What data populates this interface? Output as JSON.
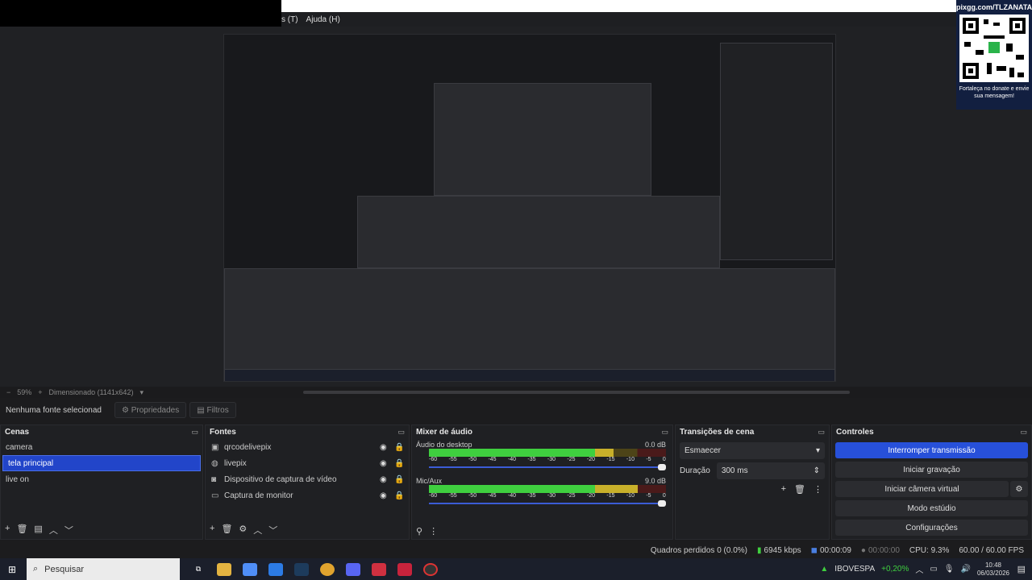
{
  "menu": {
    "items": [
      "s (T)",
      "Ajuda (H)"
    ]
  },
  "qr": {
    "url": "pixgg.com/TLZANATA",
    "message": "Fortaleça no donate e envie sua mensagem!"
  },
  "zoom": {
    "percent": "59%",
    "scaling": "Dimensionado (1141x642)"
  },
  "props": {
    "no_source": "Nenhuma fonte selecionad",
    "properties": "Propriedades",
    "filters": "Filtros"
  },
  "scenes": {
    "title": "Cenas",
    "items": [
      "camera",
      "tela principal",
      "live on"
    ],
    "selected": 1
  },
  "sources": {
    "title": "Fontes",
    "items": [
      {
        "label": "qrcodelivepix",
        "icon": "image-icon"
      },
      {
        "label": "livepix",
        "icon": "browser-icon"
      },
      {
        "label": "Dispositivo de captura de vídeo",
        "icon": "camera-icon"
      },
      {
        "label": "Captura de monitor",
        "icon": "monitor-icon"
      }
    ]
  },
  "mixer": {
    "title": "Mixer de áudio",
    "channels": [
      {
        "name": "Áudio do desktop",
        "db": "0.0 dB",
        "level": 0.78
      },
      {
        "name": "Mic/Aux",
        "db": "9.0 dB",
        "level": 0.92
      }
    ],
    "scale": [
      "-60",
      "-55",
      "-50",
      "-45",
      "-40",
      "-35",
      "-30",
      "-25",
      "-20",
      "-15",
      "-10",
      "-5",
      "0"
    ]
  },
  "transitions": {
    "title": "Transições de cena",
    "type": "Esmaecer",
    "duration_label": "Duração",
    "duration": "300 ms"
  },
  "controls": {
    "title": "Controles",
    "stop_stream": "Interromper transmissão",
    "start_rec": "Iniciar gravação",
    "virtual_cam": "Iniciar câmera virtual",
    "studio": "Modo estúdio",
    "settings": "Configurações"
  },
  "status": {
    "dropped": "Quadros perdidos 0 (0.0%)",
    "bitrate": "6945 kbps",
    "stream_time": "00:00:09",
    "rec_time": "00:00:00",
    "cpu": "CPU: 9.3%",
    "fps": "60.00 / 60.00 FPS"
  },
  "taskbar": {
    "search": "Pesquisar",
    "ticker": "IBOVESPA",
    "ticker_change": "+0,20%",
    "time": "10:48",
    "date": "06/03/2026"
  },
  "colors": {
    "accent": "#2750d9",
    "meter_green": "#3fcf3f",
    "meter_yellow": "#c8b02a",
    "meter_red": "#c42a2a"
  }
}
